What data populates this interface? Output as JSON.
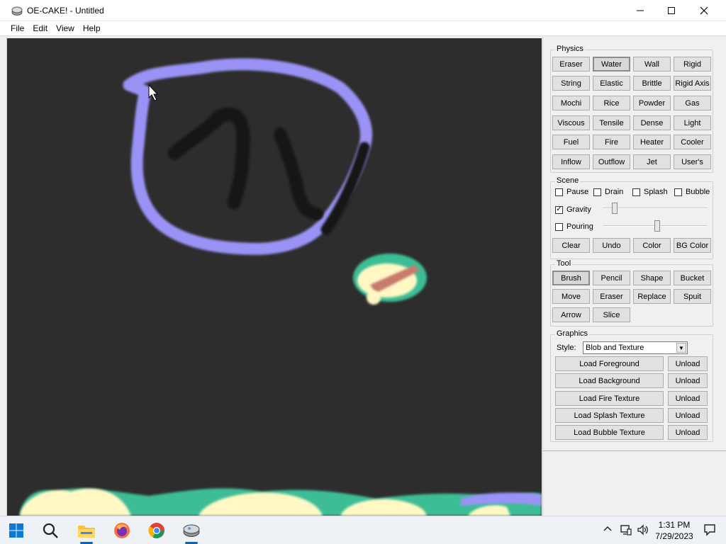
{
  "window": {
    "title": "OE-CAKE! - Untitled"
  },
  "menu": [
    "File",
    "Edit",
    "View",
    "Help"
  ],
  "physics": {
    "title": "Physics",
    "buttons": [
      "Eraser",
      "Water",
      "Wall",
      "Rigid",
      "String",
      "Elastic",
      "Brittle",
      "Rigid Axis",
      "Mochi",
      "Rice",
      "Powder",
      "Gas",
      "Viscous",
      "Tensile",
      "Dense",
      "Light",
      "Fuel",
      "Fire",
      "Heater",
      "Cooler",
      "Inflow",
      "Outflow",
      "Jet",
      "User's"
    ],
    "selected": "Water"
  },
  "scene": {
    "title": "Scene",
    "checks": [
      {
        "label": "Pause",
        "checked": false
      },
      {
        "label": "Drain",
        "checked": false
      },
      {
        "label": "Splash",
        "checked": false
      },
      {
        "label": "Bubble",
        "checked": false
      }
    ],
    "gravity": {
      "label": "Gravity",
      "checked": true,
      "level": 0.09
    },
    "pouring": {
      "label": "Pouring",
      "checked": false,
      "level": 0.52
    },
    "buttons": [
      "Clear",
      "Undo",
      "Color",
      "BG Color"
    ]
  },
  "tool": {
    "title": "Tool",
    "buttons": [
      "Brush",
      "Pencil",
      "Shape",
      "Bucket",
      "Move",
      "Eraser",
      "Replace",
      "Spuit",
      "Arrow",
      "Slice"
    ],
    "selected": "Brush"
  },
  "graphics": {
    "title": "Graphics",
    "style_label": "Style:",
    "style_value": "Blob and Texture",
    "load_buttons": [
      "Load Foreground",
      "Load Background",
      "Load Fire Texture",
      "Load Splash Texture",
      "Load Bubble Texture"
    ],
    "unload_label": "Unload"
  },
  "taskbar": {
    "apps": [
      "windows-start-icon",
      "search-icon",
      "file-explorer-icon",
      "firefox-icon",
      "chrome-icon",
      "oe-cake-icon"
    ],
    "time": "1:31 PM",
    "date": "7/29/2023"
  },
  "colors": {
    "canvas_bg": "#2d2d2d",
    "water": "#9a93f5",
    "wall": "#111111",
    "cream": "#fff8c4",
    "teal": "#3dbd96",
    "rust": "#c77a6e"
  }
}
